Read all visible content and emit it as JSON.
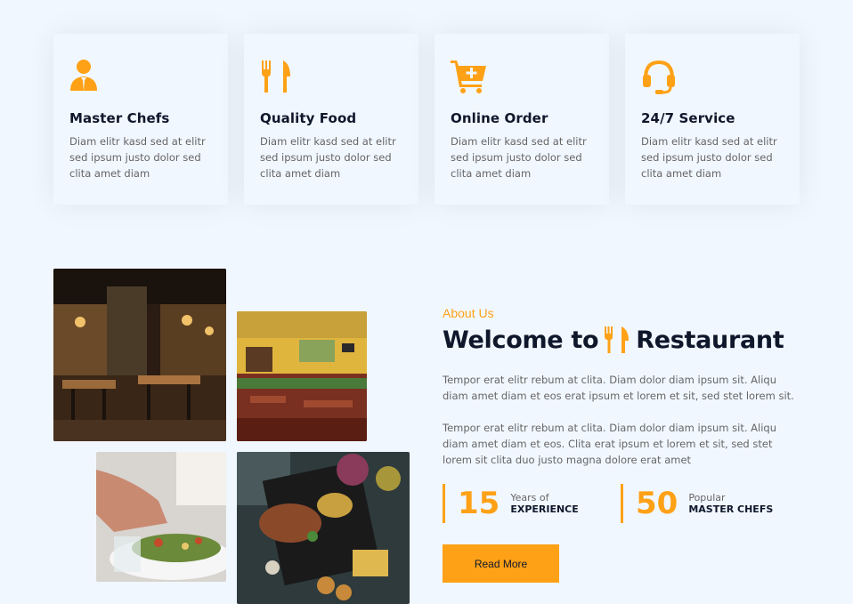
{
  "services": [
    {
      "title": "Master Chefs",
      "text": "Diam elitr kasd sed at elitr sed ipsum justo dolor sed clita amet diam",
      "icon": "chef-icon"
    },
    {
      "title": "Quality Food",
      "text": "Diam elitr kasd sed at elitr sed ipsum justo dolor sed clita amet diam",
      "icon": "utensils-icon"
    },
    {
      "title": "Online Order",
      "text": "Diam elitr kasd sed at elitr sed ipsum justo dolor sed clita amet diam",
      "icon": "cart-plus-icon"
    },
    {
      "title": "24/7 Service",
      "text": "Diam elitr kasd sed at elitr sed ipsum justo dolor sed clita amet diam",
      "icon": "headset-icon"
    }
  ],
  "about": {
    "subtitle": "About Us",
    "heading_prefix": "Welcome to",
    "heading_suffix": "Restaurant",
    "paragraph1": "Tempor erat elitr rebum at clita. Diam dolor diam ipsum sit. Aliqu diam amet diam et eos erat ipsum et lorem et sit, sed stet lorem sit.",
    "paragraph2": "Tempor erat elitr rebum at clita. Diam dolor diam ipsum sit. Aliqu diam amet diam et eos. Clita erat ipsum et lorem et sit, sed stet lorem sit clita duo justo magna dolore erat amet",
    "stats": [
      {
        "number": "15",
        "label1": "Years of",
        "label2": "EXPERIENCE"
      },
      {
        "number": "50",
        "label1": "Popular",
        "label2": "MASTER CHEFS"
      }
    ],
    "button_label": "Read More"
  },
  "colors": {
    "accent": "#fea116",
    "dark": "#0f172b",
    "text": "#666565",
    "background": "#f1f7ff"
  }
}
